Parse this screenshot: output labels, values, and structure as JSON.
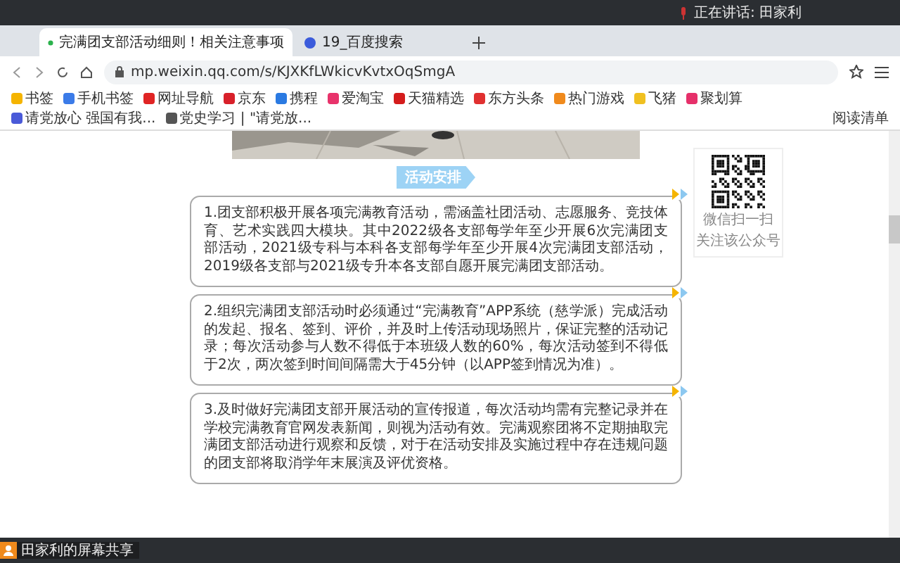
{
  "top_bar": {
    "speaking": "正在讲话: 田家利"
  },
  "tabs": [
    {
      "label": "完满团支部活动细则！相关注意事项",
      "selected": true
    },
    {
      "label": "19_百度搜索",
      "selected": false
    }
  ],
  "address_bar": {
    "url": "mp.weixin.qq.com/s/KJXKfLWkicvKvtxOqSmgA"
  },
  "bookmarks": [
    {
      "label": "书签",
      "color": "#f5b400"
    },
    {
      "label": "手机书签",
      "color": "#3b7be8"
    },
    {
      "label": "网址导航",
      "color": "#e02424"
    },
    {
      "label": "京东",
      "color": "#d8202a"
    },
    {
      "label": "携程",
      "color": "#2a7ae2"
    },
    {
      "label": "爱淘宝",
      "color": "#e8336b"
    },
    {
      "label": "天猫精选",
      "color": "#d41c1c"
    },
    {
      "label": "东方头条",
      "color": "#e03030"
    },
    {
      "label": "热门游戏",
      "color": "#f08a1c"
    },
    {
      "label": "飞猪",
      "color": "#f0c020"
    },
    {
      "label": "聚划算",
      "color": "#e6306a"
    },
    {
      "label": "请党放心 强国有我...",
      "color": "#4a5ad8"
    },
    {
      "label": "党史学习 | \"请党放...",
      "color": "#555555"
    }
  ],
  "reading_list": "阅读清单",
  "article": {
    "section_title": "活动安排",
    "items": [
      "1.团支部积极开展各项完满教育活动，需涵盖社团活动、志愿服务、竞技体育、艺术实践四大模块。其中2022级各支部每学年至少开展6次完满团支部活动，2021级专科与本科各支部每学年至少开展4次完满团支部活动，2019级各支部与2021级专升本各支部自愿开展完满团支部活动。",
      "2.组织完满团支部活动时必须通过“完满教育”APP系统（慈学派）完成活动的发起、报名、签到、评价，并及时上传活动现场照片，保证完整的活动记录；每次活动参与人数不得低于本班级人数的60%，每次活动签到不得低于2次，两次签到时间间隔需大于45分钟（以APP签到情况为准）。",
      "3.及时做好完满团支部开展活动的宣传报道，每次活动均需有完整记录并在学校完满教育官网发表新闻，则视为活动有效。完满观察团将不定期抽取完满团支部活动进行观察和反馈，对于在活动安排及实施过程中存在违规问题的团支部将取消学年末展演及评优资格。"
    ]
  },
  "qr_card": {
    "caption": [
      "微信扫一扫",
      "关注该公众号"
    ]
  },
  "share_bar": {
    "label": "田家利的屏幕共享"
  }
}
